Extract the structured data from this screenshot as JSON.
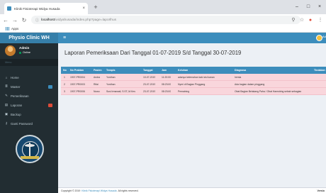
{
  "browser": {
    "tab_title": "Klinik Fisioterapi Widya Husada",
    "url_host": "localhost",
    "url_path": "/widyahusada/index.php?page=laporlhus",
    "bookmark": "Apps"
  },
  "app": {
    "brand": "Physio Clinic WH",
    "top_user": "Ad"
  },
  "sidebar": {
    "user_name": "Admin",
    "user_status": "Online",
    "menu_header": "Menu",
    "items": [
      {
        "label": "Home"
      },
      {
        "label": "Master"
      },
      {
        "label": "Pemeriksaan"
      },
      {
        "label": "Laporan"
      },
      {
        "label": "Backup"
      },
      {
        "label": "Ganti Password"
      }
    ]
  },
  "colors": {
    "primary": "#3c8dbc",
    "sidebar": "#222d32",
    "row": "#f9d6dc",
    "badge_blue": "#3c8dbc",
    "badge_red": "#dd4b39"
  },
  "page": {
    "title": "Laporan Pemeriksaan Dari Tanggal 01-07-2019 S/d Tanggal 30-07-2019"
  },
  "table": {
    "headers": [
      "No",
      "No Praktan",
      "Pasien",
      "Terapis",
      "Tanggal",
      "Jam",
      "Keluhan",
      "Diagnosa",
      "Tindakan"
    ],
    "rows": [
      [
        "1",
        "1907-PR0004",
        "Andra",
        "Yordhan",
        "10-07-2019",
        "11:20:00",
        "adanya kelemahan kaki sisi kanan",
        "hemia",
        ""
      ],
      [
        "2",
        "1907-PR0003",
        "Rifai",
        "Yordhan",
        "23-07-2019",
        "08:23:00",
        "Nyeri di Bagian Pinggang",
        "Ada bagian dalam pinggang",
        ""
      ],
      [
        "3",
        "1907-PR0006",
        "Nuwo",
        "Susi Irmawati, S.ST.,M.Kes",
        "23-07-2019",
        "08:23:00",
        "Pemaining",
        "Obat Bagian Belakang Paha / Obat Hamstring sebab sebagian",
        ""
      ]
    ]
  },
  "footer": {
    "prefix": "Copyright © 2019",
    "link": "Klinik Fisioterapi Widya Husada",
    "suffix": "All rights reserved.",
    "version": "Versio"
  }
}
